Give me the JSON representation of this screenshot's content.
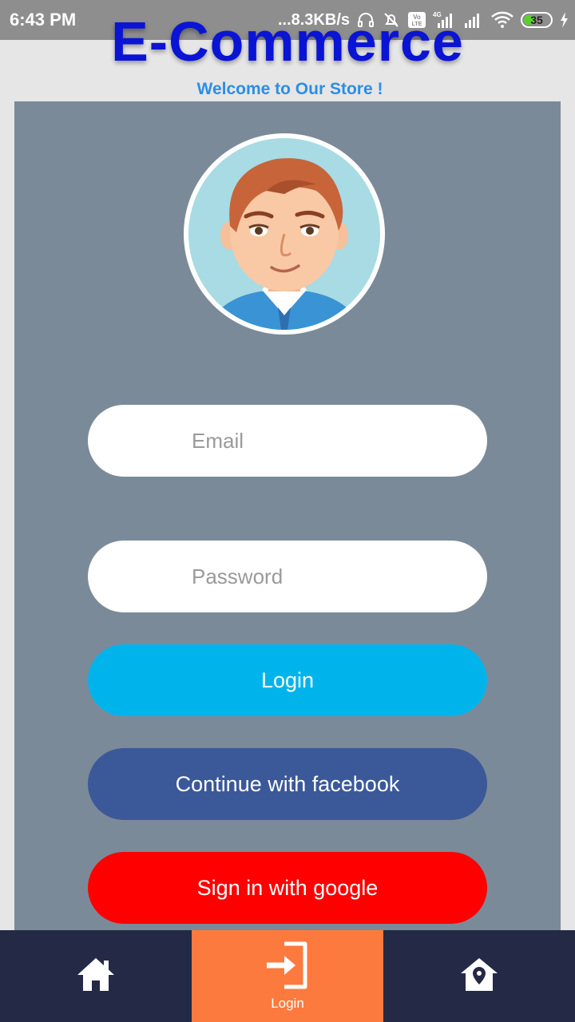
{
  "status_bar": {
    "time": "6:43 PM",
    "network_speed": "...8.3KB/s",
    "battery": "35",
    "icons": [
      "headphones-icon",
      "bell-off-icon",
      "volte-icon",
      "signal-4g-icon",
      "signal-icon",
      "wifi-icon",
      "battery-icon",
      "charging-icon"
    ]
  },
  "header": {
    "title": "E-Commerce",
    "subtitle": "Welcome to Our Store !"
  },
  "form": {
    "email_placeholder": "Email",
    "email_value": "",
    "password_placeholder": "Password",
    "password_value": "",
    "login_label": "Login",
    "facebook_label": "Continue with facebook",
    "google_label": "Sign in with google"
  },
  "bottom_nav": {
    "items": [
      {
        "icon": "home-icon",
        "label": "",
        "active": false
      },
      {
        "icon": "login-icon",
        "label": "Login",
        "active": true
      },
      {
        "icon": "location-home-icon",
        "label": "",
        "active": false
      }
    ]
  },
  "colors": {
    "title": "#0a14d4",
    "subtitle": "#2a8ee6",
    "card_bg": "#7b8a99",
    "login_button": "#00b4eb",
    "facebook_button": "#3b5999",
    "google_button": "#ff0000",
    "nav_bg": "#242a45",
    "nav_active": "#fc7a3e"
  }
}
